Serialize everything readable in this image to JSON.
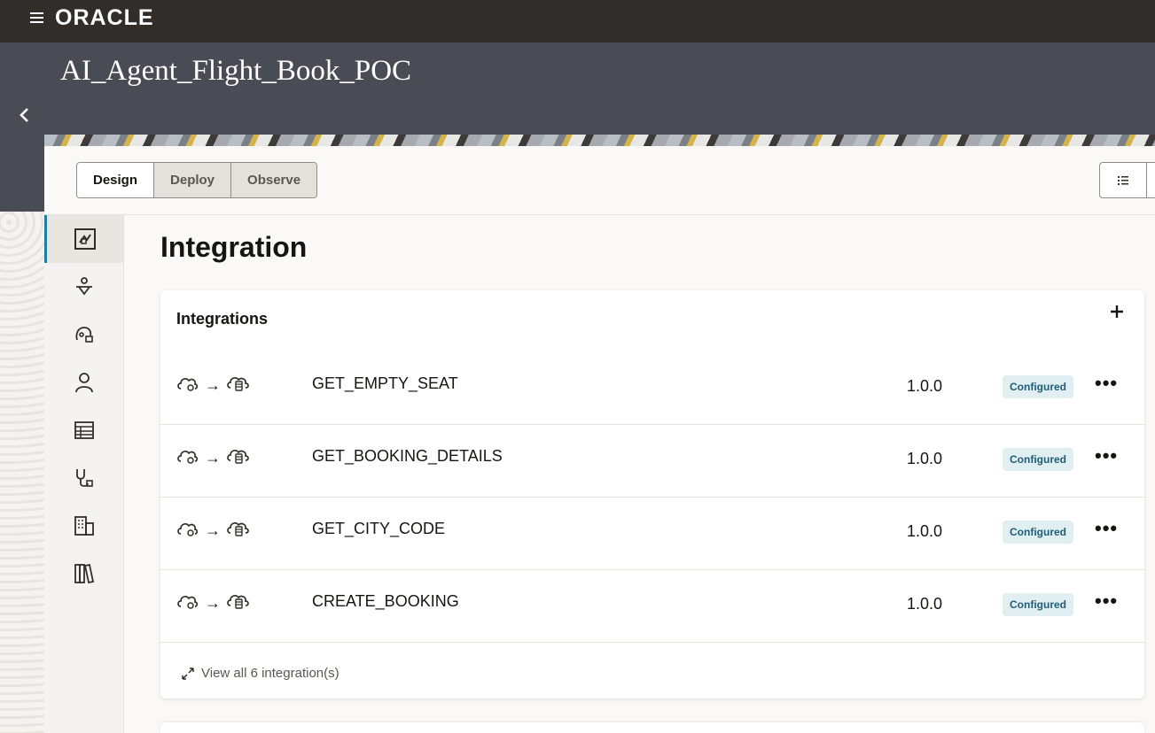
{
  "topbar": {
    "brand": "ORACLE"
  },
  "header": {
    "title": "AI_Agent_Flight_Book_POC"
  },
  "tabs": [
    {
      "label": "Design",
      "selected": true
    },
    {
      "label": "Deploy",
      "selected": false
    },
    {
      "label": "Observe",
      "selected": false
    }
  ],
  "rail": [
    "integrations-icon",
    "agent-icon",
    "connection-icon",
    "person-icon",
    "table-icon",
    "stethoscope-icon",
    "building-icon",
    "library-icon"
  ],
  "main": {
    "title": "Integration",
    "panel": {
      "title": "Integrations",
      "rows": [
        {
          "name": "GET_EMPTY_SEAT",
          "version": "1.0.0",
          "status": "Configured"
        },
        {
          "name": "GET_BOOKING_DETAILS",
          "version": "1.0.0",
          "status": "Configured"
        },
        {
          "name": "GET_CITY_CODE",
          "version": "1.0.0",
          "status": "Configured"
        },
        {
          "name": "CREATE_BOOKING",
          "version": "1.0.0",
          "status": "Configured"
        }
      ],
      "view_all": "View all 6 integration(s)"
    }
  }
}
